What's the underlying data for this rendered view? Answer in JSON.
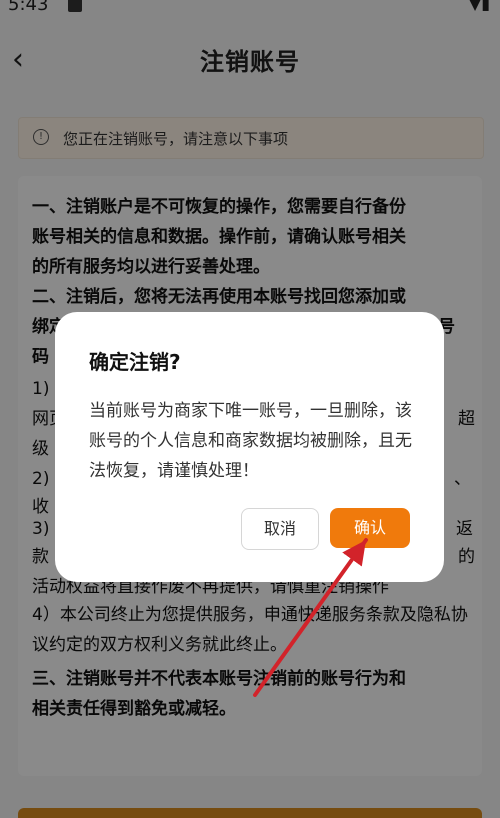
{
  "status": {
    "time": "5:43"
  },
  "header": {
    "back_label": "‹",
    "title": "注销账号"
  },
  "notice": {
    "text": "您正在注销账号，请注意以下事项"
  },
  "content": {
    "p1": [
      "一、注销账户是不可恢复的操作，您需要自行备份",
      "账号相关的信息和数据。操作前，请确认账号相关",
      "的所有服务均以进行妥善处理。"
    ],
    "p2": [
      "二、注销后，您将无法再使用本账号找回您添加或",
      "绑定",
      "号",
      "码"
    ],
    "p3": [
      "1)",
      "网页",
      "超",
      "级",
      "2)",
      "、",
      "收",
      "3)",
      "返",
      "款",
      "的",
      "活动权益将直接作废不再提供，请慎重注销操作"
    ],
    "p4": "4）本公司终止为您提供服务，申通快递服务条款及隐私协议约定的双方权利义务就此终止。",
    "p5": [
      "三、注销账号并不代表本账号注销前的账号行为和",
      "相关责任得到豁免或减轻。"
    ]
  },
  "dialog": {
    "title": "确定注销?",
    "message": "当前账号为商家下唯一账号，一旦删除，该账号的个人信息和商家数据均被删除，且无法恢复，请谨慎处理！",
    "cancel_label": "取消",
    "confirm_label": "确认"
  },
  "colors": {
    "accent": "#f07a0c",
    "arrow": "#d2232a"
  }
}
